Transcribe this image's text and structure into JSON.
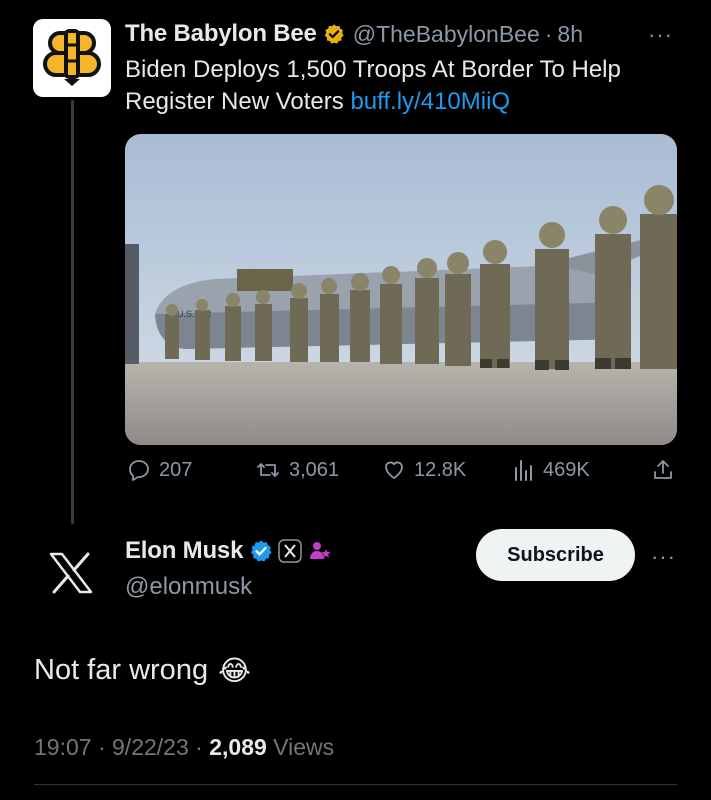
{
  "quoted_tweet": {
    "author_name": "The Babylon Bee",
    "handle": "@TheBabylonBee",
    "separator": "·",
    "time": "8h",
    "text": "Biden Deploys 1,500 Troops At Border To Help Register New Voters",
    "link": "buff.ly/410MiiQ",
    "avatar_icon": "babylon-bee-logo",
    "media_icon": "troops-boarding-air-force-plane-photo",
    "media_plane_marking": "U.S. AIR",
    "actions": {
      "replies": "207",
      "reposts": "3,061",
      "likes": "12.8K",
      "views": "469K"
    }
  },
  "main_tweet": {
    "author_name": "Elon Musk",
    "handle": "@elonmusk",
    "subscribe_label": "Subscribe",
    "text": "Not far wrong",
    "emoji": "😂",
    "time": "19:07",
    "date": "9/22/23",
    "views_count": "2,089",
    "views_label": "Views",
    "separator": "·",
    "avatar_icon": "x-logo-icon"
  },
  "more_label": "···",
  "colors": {
    "background": "#000000",
    "text": "#e7e9ea",
    "muted": "#8b98a5",
    "link": "#1d9bf0",
    "verified_gold": "#e8b20c",
    "verified_blue": "#1d9bf0",
    "subscribe_bg": "#eff3f4"
  }
}
